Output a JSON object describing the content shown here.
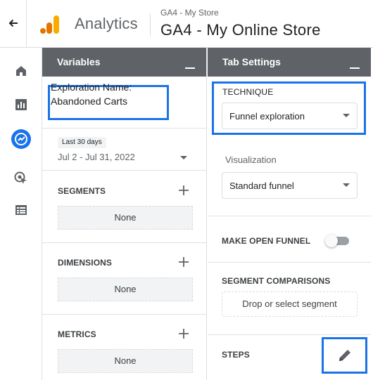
{
  "header": {
    "app_name": "Analytics",
    "account_path": "GA4 - My Store",
    "property_name": "GA4 - My Online Store"
  },
  "icons": {
    "back": "arrow-back-icon",
    "logo": "analytics-logo",
    "nav": [
      "home-icon",
      "reports-icon",
      "explore-icon",
      "advertising-icon",
      "list-icon"
    ]
  },
  "colors": {
    "highlight": "#1a73e8",
    "panel_header": "#5f6368",
    "logo_orange": "#f9ab00",
    "logo_dark_orange": "#e37400",
    "active_nav": "#1a73e8"
  },
  "variables": {
    "title": "Variables",
    "exploration_label": "Exploration Name:",
    "exploration_name": "Abandoned Carts",
    "date_badge": "Last 30 days",
    "date_range": "Jul 2 - Jul 31, 2022",
    "segments_label": "SEGMENTS",
    "segments_value": "None",
    "dimensions_label": "DIMENSIONS",
    "dimensions_value": "None",
    "metrics_label": "METRICS",
    "metrics_value": "None"
  },
  "tab_settings": {
    "title": "Tab Settings",
    "technique_label": "TECHNIQUE",
    "technique_value": "Funnel exploration",
    "visualization_label": "Visualization",
    "visualization_value": "Standard funnel",
    "open_funnel_label": "MAKE OPEN FUNNEL",
    "open_funnel_on": false,
    "segment_comparisons_label": "SEGMENT COMPARISONS",
    "segment_drop_placeholder": "Drop or select segment",
    "steps_label": "STEPS"
  }
}
